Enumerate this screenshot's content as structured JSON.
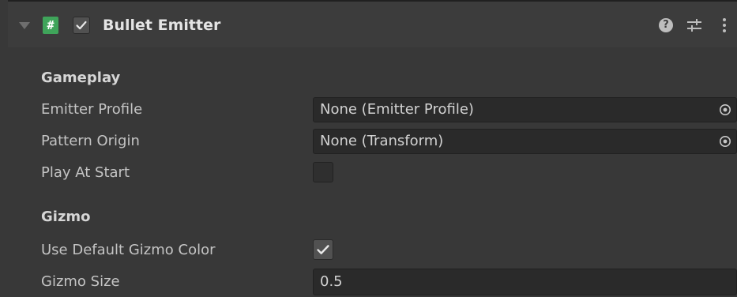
{
  "component": {
    "title": "Bullet Emitter",
    "script_icon_glyph": "#",
    "enabled": true,
    "icons": {
      "foldout": "foldout-arrow-expanded-icon",
      "script": "csharp-script-icon",
      "help": "help-icon",
      "presets": "presets-sliders-icon",
      "menu": "kebab-menu-icon"
    },
    "help_glyph": "?"
  },
  "sections": {
    "gameplay": {
      "header": "Gameplay",
      "emitter_profile": {
        "label": "Emitter Profile",
        "value": "None (Emitter Profile)"
      },
      "pattern_origin": {
        "label": "Pattern Origin",
        "value": "None (Transform)"
      },
      "play_at_start": {
        "label": "Play At Start",
        "checked": false
      }
    },
    "gizmo": {
      "header": "Gizmo",
      "use_default_gizmo_color": {
        "label": "Use Default Gizmo Color",
        "checked": true
      },
      "gizmo_size": {
        "label": "Gizmo Size",
        "value": "0.5"
      }
    }
  },
  "colors": {
    "background": "#383838",
    "header": "#3c3c3c",
    "field": "#2a2a2a",
    "script_icon": "#3fa45a",
    "text": "#c4c4c4"
  }
}
